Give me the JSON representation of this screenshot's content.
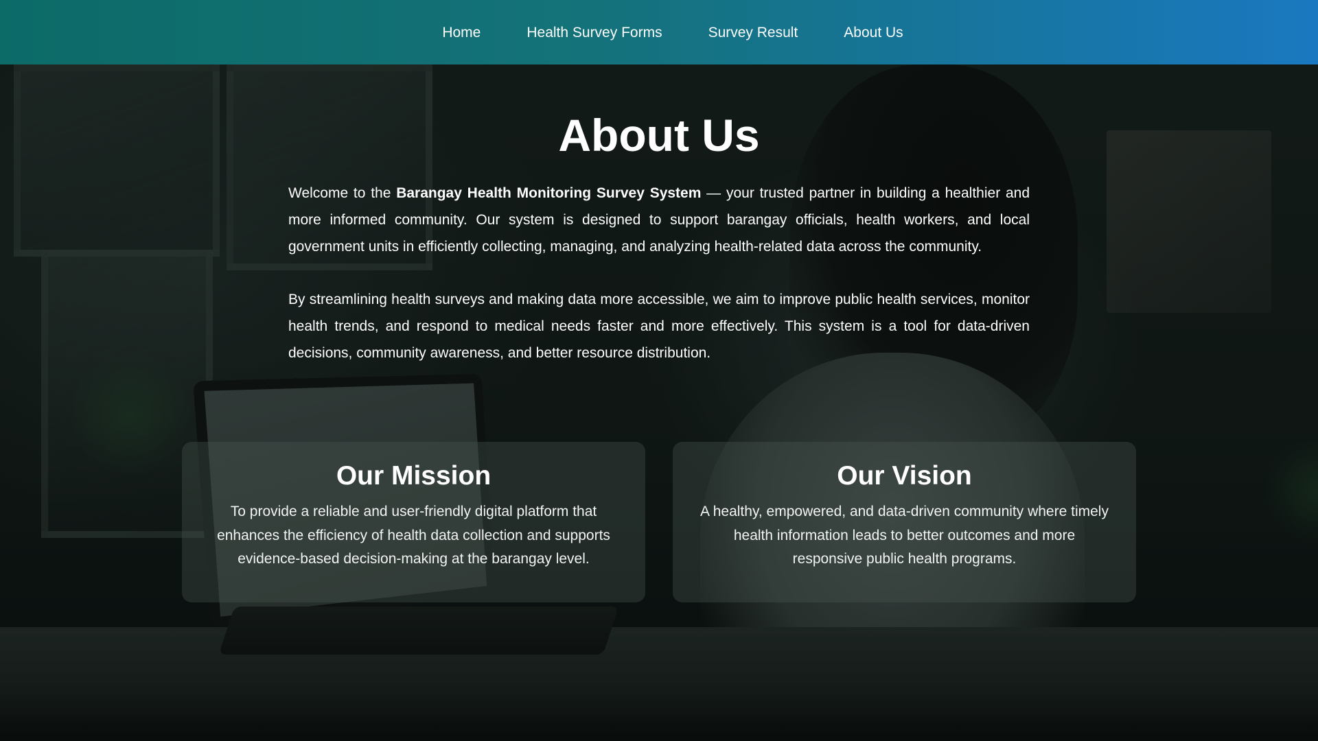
{
  "nav": {
    "items": [
      {
        "label": "Home"
      },
      {
        "label": "Health Survey Forms"
      },
      {
        "label": "Survey Result"
      },
      {
        "label": "About Us"
      }
    ]
  },
  "about": {
    "title": "About Us",
    "intro": {
      "prefix": "Welcome to the ",
      "system_name": "Barangay Health Monitoring Survey System",
      "suffix": " — your trusted partner in building a healthier and more informed community. Our system is designed to support barangay officials, health workers, and local government units in efficiently collecting, managing, and analyzing health-related data across the community."
    },
    "paragraph2": "By streamlining health surveys and making data more accessible, we aim to improve public health services, monitor health trends, and respond to medical needs faster and more effectively. This system is a tool for data-driven decisions, community awareness, and better resource distribution."
  },
  "mission": {
    "title": "Our Mission",
    "body": "To provide a reliable and user-friendly digital platform that enhances the efficiency of health data collection and supports evidence-based decision-making at the barangay level."
  },
  "vision": {
    "title": "Our Vision",
    "body": "A healthy, empowered, and data-driven community where timely health information leads to better outcomes and more responsive public health programs."
  },
  "colors": {
    "nav_gradient_start": "#0c6b67",
    "nav_gradient_end": "#1a78c0",
    "text": "#ffffff"
  }
}
